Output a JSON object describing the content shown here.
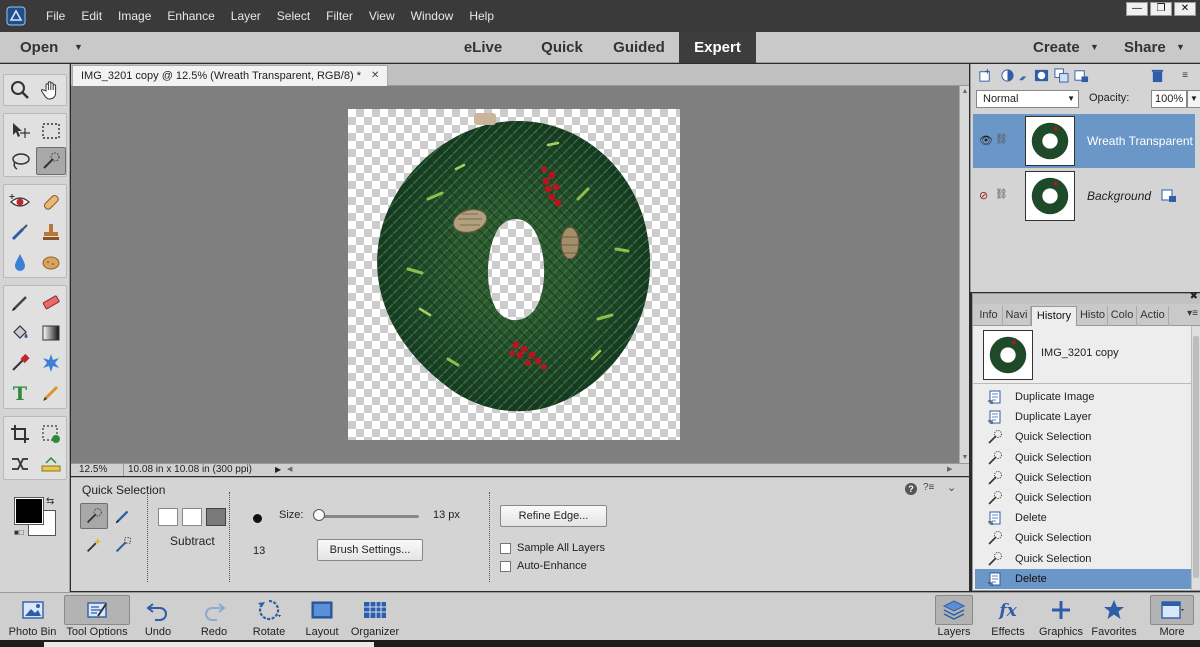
{
  "menubar": {
    "items": [
      "File",
      "Edit",
      "Image",
      "Enhance",
      "Layer",
      "Select",
      "Filter",
      "View",
      "Window",
      "Help"
    ],
    "window_controls": [
      "—",
      "❐",
      "✕"
    ]
  },
  "modebar": {
    "open": "Open",
    "tabs": [
      "eLive",
      "Quick",
      "Guided",
      "Expert"
    ],
    "active_tab": "Expert",
    "create": "Create",
    "share": "Share"
  },
  "document": {
    "tab_title": "IMG_3201 copy @ 12.5% (Wreath Transparent, RGB/8) *",
    "zoom": "12.5%",
    "doc_size": "10.08 in x 10.08 in (300 ppi)"
  },
  "tool_options": {
    "title": "Quick Selection",
    "mode_label": "Subtract",
    "brush_size_number": "13",
    "size_label": "Size:",
    "size_value": "13 px",
    "size_slider_fraction": 0.04,
    "brush_settings_button": "Brush Settings...",
    "refine_edge_button": "Refine Edge...",
    "sample_all_layers": "Sample All Layers",
    "auto_enhance": "Auto-Enhance",
    "help": "?"
  },
  "layers": {
    "blend_mode": "Normal",
    "opacity_label": "Opacity:",
    "opacity_value": "100%",
    "rows": [
      {
        "name": "Wreath Transparent",
        "active": true,
        "visible": true
      },
      {
        "name": "Background",
        "active": false,
        "visible": false
      }
    ]
  },
  "history": {
    "tabs": [
      "Info",
      "Navi",
      "History",
      "Histo",
      "Colo",
      "Actio"
    ],
    "active_tab": "History",
    "snapshot_name": "IMG_3201 copy",
    "items": [
      {
        "label": "Duplicate Image",
        "icon": "document-icon"
      },
      {
        "label": "Duplicate Layer",
        "icon": "document-icon"
      },
      {
        "label": "Quick Selection",
        "icon": "quick-selection-icon"
      },
      {
        "label": "Quick Selection",
        "icon": "quick-selection-icon"
      },
      {
        "label": "Quick Selection",
        "icon": "quick-selection-icon"
      },
      {
        "label": "Quick Selection",
        "icon": "quick-selection-icon"
      },
      {
        "label": "Delete",
        "icon": "document-icon"
      },
      {
        "label": "Quick Selection",
        "icon": "quick-selection-icon"
      },
      {
        "label": "Quick Selection",
        "icon": "quick-selection-icon"
      },
      {
        "label": "Delete",
        "icon": "document-icon",
        "active": true
      }
    ]
  },
  "bottombar": {
    "photo_bin": "Photo Bin",
    "tool_options": "Tool Options",
    "undo": "Undo",
    "redo": "Redo",
    "rotate": "Rotate",
    "layout": "Layout",
    "organizer": "Organizer",
    "layers": "Layers",
    "effects": "Effects",
    "graphics": "Graphics",
    "favorites": "Favorites",
    "more": "More"
  },
  "colors": {
    "accent_blue": "#6b96c8",
    "foreground": "#000000",
    "background": "#ffffff"
  }
}
